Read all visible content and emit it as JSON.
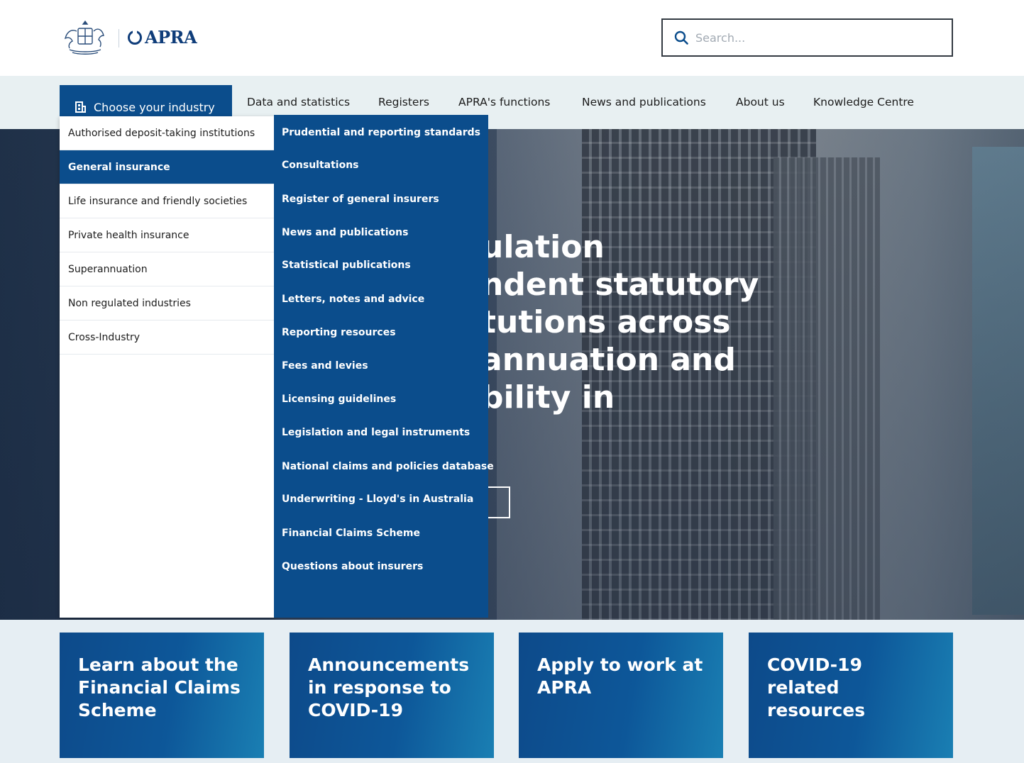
{
  "header": {
    "logo_text": "APRA",
    "search_placeholder": "Search..."
  },
  "nav": {
    "industry_button": "Choose your industry",
    "items": [
      "Data and statistics",
      "Registers",
      "APRA's functions",
      "News and publications",
      "About us",
      "Knowledge Centre"
    ]
  },
  "dropdown": {
    "industries": [
      "Authorised deposit-taking institutions",
      "General insurance",
      "Life insurance and friendly societies",
      "Private health insurance",
      "Superannuation",
      "Non regulated industries",
      "Cross-Industry"
    ],
    "selected_industry": "General insurance",
    "sub_items": [
      "Prudential and reporting standards",
      "Consultations",
      "Register of general insurers",
      "News and publications",
      "Statistical publications",
      "Letters, notes and advice",
      "Reporting resources",
      "Fees and levies",
      "Licensing guidelines",
      "Legislation and legal instruments",
      "National claims and policies database",
      "Underwriting - Lloyd's in Australia",
      "Financial Claims Scheme",
      "Questions about insurers"
    ]
  },
  "hero": {
    "lines": [
      "ulation",
      "ndent statutory",
      "tutions across",
      "annuation and",
      "bility in"
    ]
  },
  "cards": [
    {
      "title": "Learn about the Financial Claims Scheme"
    },
    {
      "title": "Announcements in response to COVID-19"
    },
    {
      "title": "Apply to work at APRA"
    },
    {
      "title": "COVID-19 related resources"
    }
  ],
  "colors": {
    "brand_blue": "#0b4d8c",
    "nav_bg": "#e8f0f2",
    "cards_bg": "#e6eef3"
  }
}
